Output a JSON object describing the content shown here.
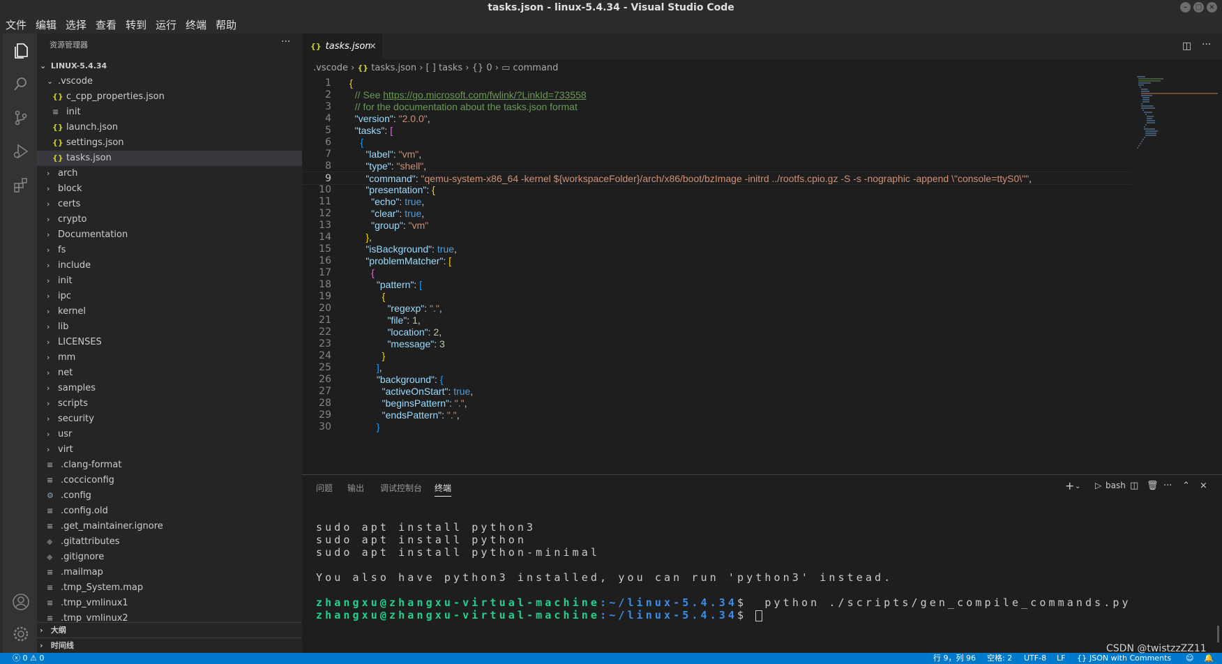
{
  "window": {
    "title": "tasks.json - linux-5.4.34 - Visual Studio Code"
  },
  "menu": [
    "文件",
    "编辑",
    "选择",
    "查看",
    "转到",
    "运行",
    "终端",
    "帮助"
  ],
  "activity_bar": [
    "explorer-icon",
    "search-icon",
    "source-control-icon",
    "run-debug-icon",
    "extensions-icon",
    "account-icon",
    "settings-gear-icon"
  ],
  "sidebar": {
    "title": "资源管理器",
    "more": "···",
    "root": "LINUX-5.4.34",
    "tree": [
      {
        "label": ".vscode",
        "kind": "folder-open",
        "indent": 1
      },
      {
        "label": "c_cpp_properties.json",
        "kind": "json",
        "indent": 2
      },
      {
        "label": "init",
        "kind": "text",
        "indent": 2
      },
      {
        "label": "launch.json",
        "kind": "json",
        "indent": 2
      },
      {
        "label": "settings.json",
        "kind": "json",
        "indent": 2
      },
      {
        "label": "tasks.json",
        "kind": "json",
        "indent": 2,
        "selected": true
      },
      {
        "label": "arch",
        "kind": "folder",
        "indent": 1
      },
      {
        "label": "block",
        "kind": "folder",
        "indent": 1
      },
      {
        "label": "certs",
        "kind": "folder",
        "indent": 1
      },
      {
        "label": "crypto",
        "kind": "folder",
        "indent": 1
      },
      {
        "label": "Documentation",
        "kind": "folder",
        "indent": 1
      },
      {
        "label": "fs",
        "kind": "folder",
        "indent": 1
      },
      {
        "label": "include",
        "kind": "folder",
        "indent": 1
      },
      {
        "label": "init",
        "kind": "folder",
        "indent": 1
      },
      {
        "label": "ipc",
        "kind": "folder",
        "indent": 1
      },
      {
        "label": "kernel",
        "kind": "folder",
        "indent": 1
      },
      {
        "label": "lib",
        "kind": "folder",
        "indent": 1
      },
      {
        "label": "LICENSES",
        "kind": "folder",
        "indent": 1
      },
      {
        "label": "mm",
        "kind": "folder",
        "indent": 1
      },
      {
        "label": "net",
        "kind": "folder",
        "indent": 1
      },
      {
        "label": "samples",
        "kind": "folder",
        "indent": 1
      },
      {
        "label": "scripts",
        "kind": "folder",
        "indent": 1
      },
      {
        "label": "security",
        "kind": "folder",
        "indent": 1
      },
      {
        "label": "usr",
        "kind": "folder",
        "indent": 1
      },
      {
        "label": "virt",
        "kind": "folder",
        "indent": 1
      },
      {
        "label": ".clang-format",
        "kind": "text",
        "indent": 1
      },
      {
        "label": ".cocciconfig",
        "kind": "text",
        "indent": 1
      },
      {
        "label": ".config",
        "kind": "gear",
        "indent": 1
      },
      {
        "label": ".config.old",
        "kind": "text",
        "indent": 1
      },
      {
        "label": ".get_maintainer.ignore",
        "kind": "text",
        "indent": 1
      },
      {
        "label": ".gitattributes",
        "kind": "git",
        "indent": 1
      },
      {
        "label": ".gitignore",
        "kind": "git",
        "indent": 1
      },
      {
        "label": ".mailmap",
        "kind": "text",
        "indent": 1
      },
      {
        "label": ".tmp_System.map",
        "kind": "text",
        "indent": 1
      },
      {
        "label": ".tmp_vmlinux1",
        "kind": "text",
        "indent": 1
      },
      {
        "label": ".tmp_vmlinux2",
        "kind": "text",
        "indent": 1
      }
    ],
    "outline": "大纲",
    "timeline": "时间线"
  },
  "editor": {
    "tab_label": "tasks.json",
    "breadcrumb": [
      ".vscode",
      "tasks.json",
      "tasks",
      "0",
      "command"
    ],
    "current_line": 9,
    "lines": [
      [
        [
          "{",
          "y"
        ]
      ],
      [
        [
          "  // See ",
          "c"
        ],
        [
          "https://go.microsoft.com/fwlink/?LinkId=733558",
          "link"
        ]
      ],
      [
        [
          "  // for the documentation about the tasks.json format",
          "c"
        ]
      ],
      [
        [
          "  \"version\"",
          "k"
        ],
        [
          ": ",
          "p"
        ],
        [
          "\"2.0.0\"",
          "s"
        ],
        [
          ",",
          "p"
        ]
      ],
      [
        [
          "  \"tasks\"",
          "k"
        ],
        [
          ": ",
          "p"
        ],
        [
          "[",
          "m"
        ]
      ],
      [
        [
          "    {",
          "bl"
        ]
      ],
      [
        [
          "      \"label\"",
          "k"
        ],
        [
          ": ",
          "p"
        ],
        [
          "\"vm\"",
          "s"
        ],
        [
          ",",
          "p"
        ]
      ],
      [
        [
          "      \"type\"",
          "k"
        ],
        [
          ": ",
          "p"
        ],
        [
          "\"shell\"",
          "s"
        ],
        [
          ",",
          "p"
        ]
      ],
      [
        [
          "      \"command\"",
          "k"
        ],
        [
          ": ",
          "p"
        ],
        [
          "\"qemu-system-x86_64 -kernel ${workspaceFolder}/arch/x86/boot/bzImage -initrd ../rootfs.cpio.gz -S -s -nographic -append \\\"console=ttyS0\\\"\"",
          "s"
        ],
        [
          ",",
          "p"
        ]
      ],
      [
        [
          "      \"presentation\"",
          "k"
        ],
        [
          ": ",
          "p"
        ],
        [
          "{",
          "y"
        ]
      ],
      [
        [
          "        \"echo\"",
          "k"
        ],
        [
          ": ",
          "p"
        ],
        [
          "true",
          "b"
        ],
        [
          ",",
          "p"
        ]
      ],
      [
        [
          "        \"clear\"",
          "k"
        ],
        [
          ": ",
          "p"
        ],
        [
          "true",
          "b"
        ],
        [
          ",",
          "p"
        ]
      ],
      [
        [
          "        \"group\"",
          "k"
        ],
        [
          ": ",
          "p"
        ],
        [
          "\"vm\"",
          "s"
        ]
      ],
      [
        [
          "      }",
          "y"
        ],
        [
          ",",
          "p"
        ]
      ],
      [
        [
          "      \"isBackground\"",
          "k"
        ],
        [
          ": ",
          "p"
        ],
        [
          "true",
          "b"
        ],
        [
          ",",
          "p"
        ]
      ],
      [
        [
          "      \"problemMatcher\"",
          "k"
        ],
        [
          ": ",
          "p"
        ],
        [
          "[",
          "y"
        ]
      ],
      [
        [
          "        {",
          "m"
        ]
      ],
      [
        [
          "          \"pattern\"",
          "k"
        ],
        [
          ": ",
          "p"
        ],
        [
          "[",
          "bl"
        ]
      ],
      [
        [
          "            {",
          "y"
        ]
      ],
      [
        [
          "              \"regexp\"",
          "k"
        ],
        [
          ": ",
          "p"
        ],
        [
          "\".\"",
          "s"
        ],
        [
          ",",
          "p"
        ]
      ],
      [
        [
          "              \"file\"",
          "k"
        ],
        [
          ": ",
          "p"
        ],
        [
          "1",
          "n"
        ],
        [
          ",",
          "p"
        ]
      ],
      [
        [
          "              \"location\"",
          "k"
        ],
        [
          ": ",
          "p"
        ],
        [
          "2",
          "n"
        ],
        [
          ",",
          "p"
        ]
      ],
      [
        [
          "              \"message\"",
          "k"
        ],
        [
          ": ",
          "p"
        ],
        [
          "3",
          "n"
        ]
      ],
      [
        [
          "            }",
          "y"
        ]
      ],
      [
        [
          "          ]",
          "bl"
        ],
        [
          ",",
          "p"
        ]
      ],
      [
        [
          "          \"background\"",
          "k"
        ],
        [
          ": ",
          "p"
        ],
        [
          "{",
          "bl"
        ]
      ],
      [
        [
          "            \"activeOnStart\"",
          "k"
        ],
        [
          ": ",
          "p"
        ],
        [
          "true",
          "b"
        ],
        [
          ",",
          "p"
        ]
      ],
      [
        [
          "            \"beginsPattern\"",
          "k"
        ],
        [
          ": ",
          "p"
        ],
        [
          "\".\"",
          "s"
        ],
        [
          ",",
          "p"
        ]
      ],
      [
        [
          "            \"endsPattern\"",
          "k"
        ],
        [
          ": ",
          "p"
        ],
        [
          "\".\"",
          "s"
        ],
        [
          ",",
          "p"
        ]
      ],
      [
        [
          "          }",
          "bl"
        ]
      ]
    ]
  },
  "panel": {
    "tabs": [
      "问题",
      "输出",
      "调试控制台",
      "终端"
    ],
    "active_tab": "终端",
    "terminal_name": "bash",
    "terminal": [
      {
        "text": "sudo apt install python3"
      },
      {
        "text": "sudo apt install python"
      },
      {
        "text": "sudo apt install python-minimal"
      },
      {
        "text": ""
      },
      {
        "text": "You also have python3 installed, you can run 'python3' instead."
      },
      {
        "text": ""
      },
      {
        "user": "zhangxu@zhangxu-virtual-machine",
        "path": ":~/linux-5.4.34",
        "cmd": "$  python ./scripts/gen_compile_commands.py"
      },
      {
        "user": "zhangxu@zhangxu-virtual-machine",
        "path": ":~/linux-5.4.34",
        "cmd": "$ "
      }
    ]
  },
  "status_bar": {
    "errors": "0",
    "warnings": "0",
    "position": "行 9，列 96",
    "spaces": "空格: 2",
    "encoding": "UTF-8",
    "eol": "LF",
    "language": "JSON with Comments",
    "watermark": "CSDN @twistzzZZ11"
  }
}
